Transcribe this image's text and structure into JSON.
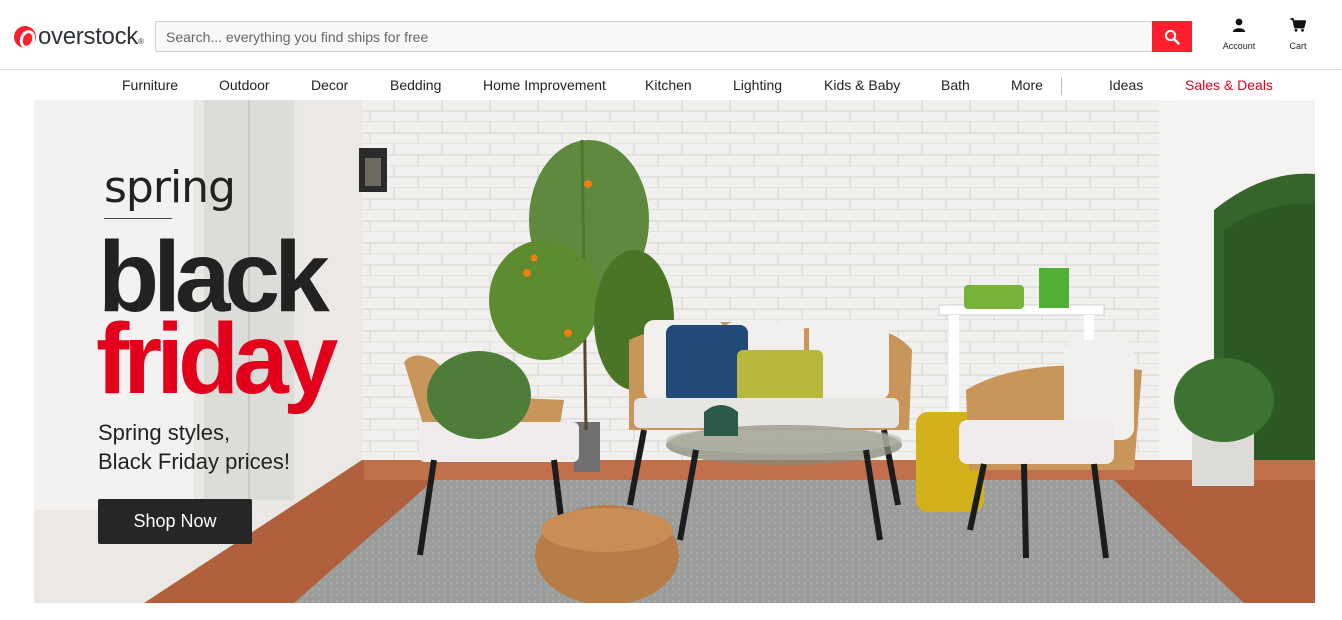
{
  "header": {
    "logo_text": "overstock",
    "logo_mark": "®",
    "search": {
      "placeholder": "Search... everything you find ships for free",
      "icon": "search-icon"
    },
    "account_label": "Account",
    "cart_label": "Cart",
    "colors": {
      "brand_red": "#ff1f2c",
      "text": "#222222"
    }
  },
  "nav": {
    "items": [
      "Furniture",
      "Outdoor",
      "Decor",
      "Bedding",
      "Home Improvement",
      "Kitchen",
      "Lighting",
      "Kids & Baby",
      "Bath",
      "More"
    ],
    "ideas": "Ideas",
    "deals": "Sales & Deals",
    "deals_color": "#e2001a"
  },
  "hero": {
    "kicker": "spring",
    "headline_1": "black",
    "headline_2": "friday",
    "subtext_1": "Spring styles,",
    "subtext_2": "Black Friday prices!",
    "cta": "Shop Now",
    "accent_color": "#e2001a"
  }
}
